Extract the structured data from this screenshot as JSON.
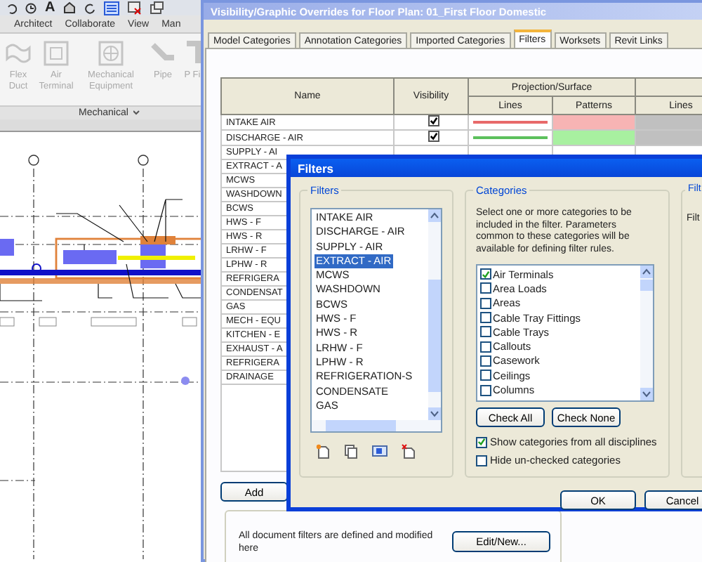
{
  "quick_access": {
    "text_icon": "A"
  },
  "ribbon": {
    "tabs": [
      {
        "label": "Architect",
        "selected": false
      },
      {
        "label": "Collaborate",
        "selected": false
      },
      {
        "label": "View",
        "selected": false
      },
      {
        "label": "Man",
        "selected": false
      }
    ],
    "buttons": [
      {
        "label": "Flex Duct",
        "kind": "flexduct"
      },
      {
        "label": "Air Terminal",
        "kind": "terminal"
      },
      {
        "label": "Mechanical Equipment",
        "kind": "equipment"
      },
      {
        "label": "Pipe",
        "kind": "pipe"
      },
      {
        "label": "P Fi",
        "kind": "fitting"
      }
    ],
    "panel_label": "Mechanical"
  },
  "vg_dialog": {
    "title": "Visibility/Graphic Overrides for Floor Plan: 01_First Floor Domestic",
    "tabs": [
      {
        "label": "Model Categories",
        "selected": false
      },
      {
        "label": "Annotation Categories",
        "selected": false
      },
      {
        "label": "Imported Categories",
        "selected": false
      },
      {
        "label": "Filters",
        "selected": true
      },
      {
        "label": "Worksets",
        "selected": false
      },
      {
        "label": "Revit Links",
        "selected": false
      }
    ],
    "table": {
      "columns": [
        "Name",
        "Visibility"
      ],
      "group_header": "Projection/Surface",
      "subcolumns": [
        "Lines",
        "Patterns",
        "Lines"
      ],
      "rows": [
        {
          "name": "INTAKE AIR",
          "visible": true,
          "line": {
            "color": "#e86a6a"
          },
          "pattern": {
            "color": "#f7b4b4"
          }
        },
        {
          "name": "DISCHARGE - AIR",
          "visible": true,
          "line": {
            "color": "#5cc05c"
          },
          "pattern": {
            "color": "#a8f0a0"
          }
        },
        {
          "name": "SUPPLY - AI"
        },
        {
          "name": "EXTRACT - A"
        },
        {
          "name": "MCWS"
        },
        {
          "name": "WASHDOWN"
        },
        {
          "name": "BCWS"
        },
        {
          "name": "HWS - F"
        },
        {
          "name": "HWS - R"
        },
        {
          "name": "LRHW - F"
        },
        {
          "name": "LPHW - R"
        },
        {
          "name": "REFRIGERA"
        },
        {
          "name": "CONDENSAT"
        },
        {
          "name": "GAS"
        },
        {
          "name": "MECH - EQU"
        },
        {
          "name": "KITCHEN - E"
        },
        {
          "name": "EXHAUST - A"
        },
        {
          "name": "REFRIGERA"
        },
        {
          "name": "DRAINAGE"
        }
      ]
    },
    "add_button": "Add",
    "note": "All document filters are defined and modified here",
    "edit_button": "Edit/New..."
  },
  "filters_dialog": {
    "title": "Filters",
    "filters_group": "Filters",
    "filters": [
      {
        "label": "INTAKE AIR",
        "selected": false
      },
      {
        "label": "DISCHARGE - AIR",
        "selected": false
      },
      {
        "label": "SUPPLY - AIR",
        "selected": false
      },
      {
        "label": "EXTRACT - AIR",
        "selected": true
      },
      {
        "label": "MCWS",
        "selected": false
      },
      {
        "label": "WASHDOWN",
        "selected": false
      },
      {
        "label": "BCWS",
        "selected": false
      },
      {
        "label": "HWS - F",
        "selected": false
      },
      {
        "label": "HWS - R",
        "selected": false
      },
      {
        "label": "LRHW - F",
        "selected": false
      },
      {
        "label": "LPHW - R",
        "selected": false
      },
      {
        "label": "REFRIGERATION-S",
        "selected": false
      },
      {
        "label": "CONDENSATE",
        "selected": false
      },
      {
        "label": "GAS",
        "selected": false
      }
    ],
    "categories_group": "Categories",
    "categories_note": "Select one or more categories to be included in the filter.  Parameters common to these categories will be available for defining filter rules.",
    "categories": [
      {
        "label": "Air Terminals",
        "checked": true
      },
      {
        "label": "Area Loads",
        "checked": false
      },
      {
        "label": "Areas",
        "checked": false
      },
      {
        "label": "Cable Tray Fittings",
        "checked": false
      },
      {
        "label": "Cable Trays",
        "checked": false
      },
      {
        "label": "Callouts",
        "checked": false
      },
      {
        "label": "Casework",
        "checked": false
      },
      {
        "label": "Ceilings",
        "checked": false
      },
      {
        "label": "Columns",
        "checked": false
      }
    ],
    "check_all": "Check All",
    "check_none": "Check None",
    "options": [
      {
        "label": "Show categories from all disciplines",
        "checked": true
      },
      {
        "label": "Hide un-checked categories",
        "checked": false
      }
    ],
    "rules_group": "Filt",
    "rules_text": "Filt",
    "ok": "OK",
    "cancel": "Cancel"
  }
}
